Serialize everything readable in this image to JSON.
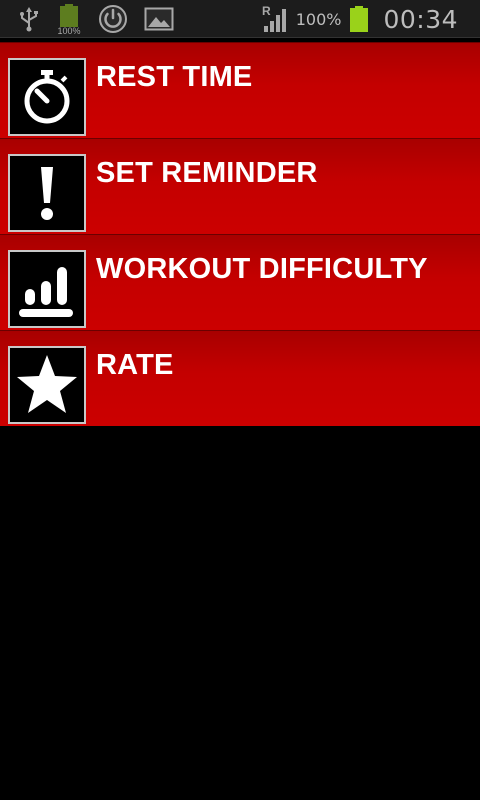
{
  "status_bar": {
    "battery_badge_text": "100%",
    "network_badge": "R",
    "battery_percent": "100%",
    "time": "00:34",
    "icons": [
      "usb-icon",
      "battery-full-icon",
      "power-icon",
      "image-icon",
      "signal-icon",
      "battery-icon"
    ]
  },
  "menu": {
    "items": [
      {
        "label": "REST TIME",
        "icon": "stopwatch-icon"
      },
      {
        "label": "SET REMINDER",
        "icon": "exclamation-icon"
      },
      {
        "label": "WORKOUT DIFFICULTY",
        "icon": "difficulty-bars-icon"
      },
      {
        "label": "RATE",
        "icon": "star-icon"
      }
    ]
  },
  "colors": {
    "item_red": "#cc0000",
    "item_red_top": "#a80000",
    "icon_box_border": "#c8c8c8",
    "background": "#000000",
    "battery_green": "#9ad21a"
  }
}
